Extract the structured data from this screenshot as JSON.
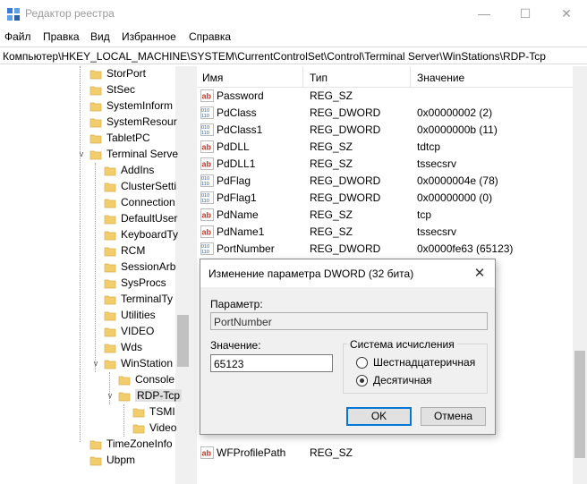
{
  "window": {
    "title": "Редактор реестра",
    "min_glyph": "—",
    "max_glyph": "☐",
    "close_glyph": "✕"
  },
  "menu": [
    "Файл",
    "Правка",
    "Вид",
    "Избранное",
    "Справка"
  ],
  "address": "Компьютер\\HKEY_LOCAL_MACHINE\\SYSTEM\\CurrentControlSet\\Control\\Terminal Server\\WinStations\\RDP-Tcp",
  "tree": [
    {
      "label": "StorPort",
      "level": 0,
      "expander": ""
    },
    {
      "label": "StSec",
      "level": 0,
      "expander": ""
    },
    {
      "label": "SystemInform",
      "level": 0,
      "expander": ""
    },
    {
      "label": "SystemResour",
      "level": 0,
      "expander": ""
    },
    {
      "label": "TabletPC",
      "level": 0,
      "expander": ""
    },
    {
      "label": "Terminal Serve",
      "level": 0,
      "expander": "v"
    },
    {
      "label": "AddIns",
      "level": 1,
      "expander": ""
    },
    {
      "label": "ClusterSetti",
      "level": 1,
      "expander": ""
    },
    {
      "label": "Connection",
      "level": 1,
      "expander": ""
    },
    {
      "label": "DefaultUser",
      "level": 1,
      "expander": ""
    },
    {
      "label": "KeyboardTy",
      "level": 1,
      "expander": ""
    },
    {
      "label": "RCM",
      "level": 1,
      "expander": ""
    },
    {
      "label": "SessionArb",
      "level": 1,
      "expander": ""
    },
    {
      "label": "SysProcs",
      "level": 1,
      "expander": ""
    },
    {
      "label": "TerminalTy",
      "level": 1,
      "expander": ""
    },
    {
      "label": "Utilities",
      "level": 1,
      "expander": ""
    },
    {
      "label": "VIDEO",
      "level": 1,
      "expander": ""
    },
    {
      "label": "Wds",
      "level": 1,
      "expander": ""
    },
    {
      "label": "WinStation",
      "level": 1,
      "expander": "v"
    },
    {
      "label": "Console",
      "level": 2,
      "expander": ""
    },
    {
      "label": "RDP-Tcp",
      "level": 2,
      "expander": "v",
      "selected": true
    },
    {
      "label": "TSMI",
      "level": 3,
      "expander": ""
    },
    {
      "label": "Video",
      "level": 3,
      "expander": ""
    },
    {
      "label": "TimeZoneInfo",
      "level": 0,
      "expander": ""
    },
    {
      "label": "Ubpm",
      "level": 0,
      "expander": ""
    }
  ],
  "list": {
    "headers": [
      "Имя",
      "Тип",
      "Значение"
    ],
    "rows": [
      {
        "icon": "ab",
        "name": "Password",
        "type": "REG_SZ",
        "value": ""
      },
      {
        "icon": "bin",
        "name": "PdClass",
        "type": "REG_DWORD",
        "value": "0x00000002 (2)"
      },
      {
        "icon": "bin",
        "name": "PdClass1",
        "type": "REG_DWORD",
        "value": "0x0000000b (11)"
      },
      {
        "icon": "ab",
        "name": "PdDLL",
        "type": "REG_SZ",
        "value": "tdtcp"
      },
      {
        "icon": "ab",
        "name": "PdDLL1",
        "type": "REG_SZ",
        "value": "tssecsrv"
      },
      {
        "icon": "bin",
        "name": "PdFlag",
        "type": "REG_DWORD",
        "value": "0x0000004e (78)"
      },
      {
        "icon": "bin",
        "name": "PdFlag1",
        "type": "REG_DWORD",
        "value": "0x00000000 (0)"
      },
      {
        "icon": "ab",
        "name": "PdName",
        "type": "REG_SZ",
        "value": "tcp"
      },
      {
        "icon": "ab",
        "name": "PdName1",
        "type": "REG_SZ",
        "value": "tssecsrv"
      },
      {
        "icon": "bin",
        "name": "PortNumber",
        "type": "REG_DWORD",
        "value": "0x0000fe63 (65123)"
      }
    ],
    "bottom_rows": [
      {
        "icon": "ab",
        "name": "WFProfilePath",
        "type": "REG_SZ",
        "value": ""
      }
    ]
  },
  "dialog": {
    "title": "Изменение параметра DWORD (32 бита)",
    "param_label": "Параметр:",
    "param_value": "PortNumber",
    "value_label": "Значение:",
    "value_value": "65123",
    "base_title": "Система исчисления",
    "hex_label": "Шестнадцатеричная",
    "dec_label": "Десятичная",
    "selected_base": "dec",
    "ok_label": "OK",
    "cancel_label": "Отмена"
  },
  "colors": {
    "folder": "#f1cd6b",
    "folder_dark": "#dcb04a",
    "accent": "#0078d7",
    "ab_icon": "#c0392b",
    "bin_icon": "#1f5fbf"
  }
}
